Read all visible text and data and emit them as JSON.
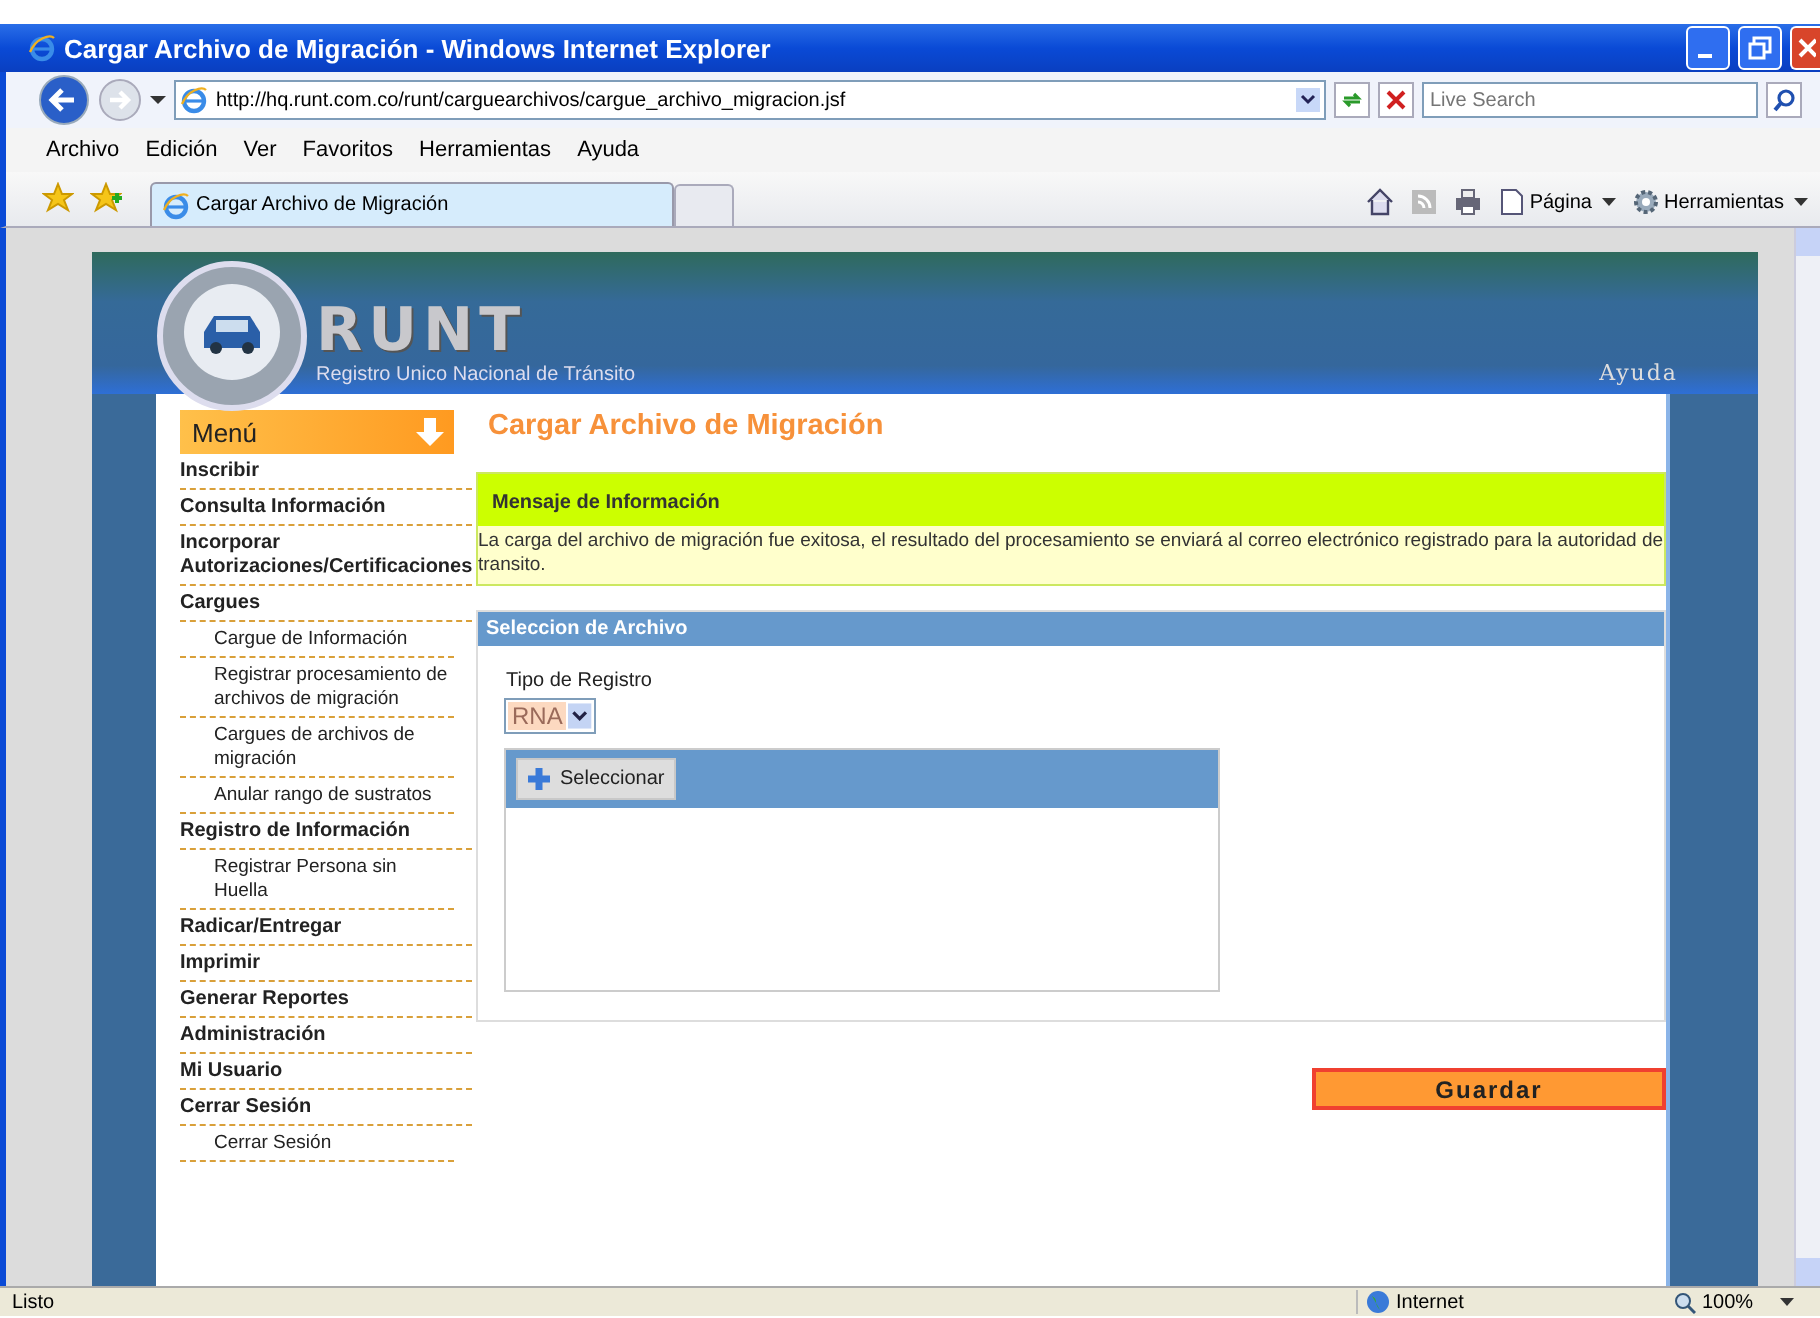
{
  "window": {
    "title": "Cargar Archivo de Migración - Windows Internet Explorer"
  },
  "browser": {
    "address": "http://hq.runt.com.co/runt/carguearchivos/cargue_archivo_migracion.jsf",
    "search_placeholder": "Live Search",
    "menu_bar": [
      "Archivo",
      "Edición",
      "Ver",
      "Favoritos",
      "Herramientas",
      "Ayuda"
    ],
    "tab": {
      "title": "Cargar Archivo de Migración"
    },
    "toolbar": [
      "Página",
      "Herramientas"
    ]
  },
  "header": {
    "logo": "RUNT",
    "subtitle": "Registro Unico Nacional de Tránsito",
    "help": "Ayuda"
  },
  "sidebar": {
    "title": "Menú",
    "items": [
      {
        "label": "Inscribir"
      },
      {
        "label": "Consulta Información"
      },
      {
        "label": "Incorporar Autorizaciones/Certificaciones"
      },
      {
        "label": "Cargues",
        "children": [
          {
            "label": "Cargue de Información"
          },
          {
            "label": "Registrar procesamiento de archivos de migración"
          },
          {
            "label": "Cargues de archivos de migración"
          },
          {
            "label": "Anular rango de sustratos"
          }
        ]
      },
      {
        "label": "Registro de Información",
        "children": [
          {
            "label": "Registrar Persona sin Huella"
          }
        ]
      },
      {
        "label": "Radicar/Entregar"
      },
      {
        "label": "Imprimir"
      },
      {
        "label": "Generar Reportes"
      },
      {
        "label": "Administración"
      },
      {
        "label": "Mi Usuario"
      },
      {
        "label": "Cerrar Sesión",
        "children": [
          {
            "label": "Cerrar Sesión"
          }
        ]
      }
    ]
  },
  "main": {
    "title": "Cargar Archivo de Migración",
    "message": {
      "heading": "Mensaje de Información",
      "text": "La carga del archivo de migración fue exitosa, el resultado del procesamiento se enviará al correo electrónico registrado para la autoridad de transito."
    },
    "section": {
      "title": "Seleccion de Archivo",
      "field_label": "Tipo de Registro",
      "select_value": "RNA",
      "upload_button": "Seleccionar"
    },
    "save_button": "Guardar"
  },
  "status_bar": {
    "text": "Listo",
    "zone": "Internet",
    "zoom": "100%"
  }
}
